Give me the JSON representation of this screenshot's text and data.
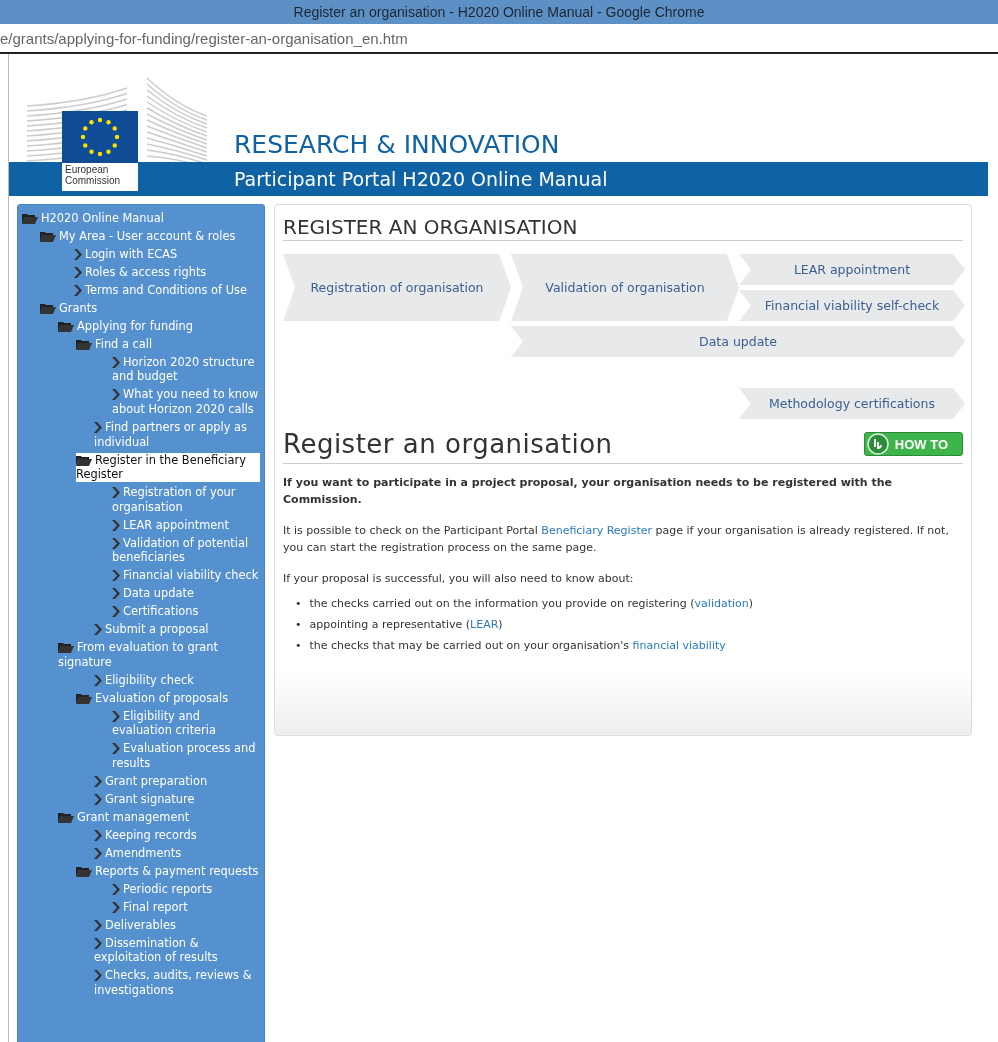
{
  "window": {
    "title": "Register an organisation - H2020 Online Manual - Google Chrome",
    "url": "e/grants/applying-for-funding/register-an-organisation_en.htm"
  },
  "header": {
    "logo_text": "European Commission",
    "title": "RESEARCH & INNOVATION",
    "subtitle": "Participant Portal H2020 Online Manual"
  },
  "sidebar": {
    "tree": [
      {
        "label": "H2020 Online Manual",
        "kind": "folder",
        "selected": false,
        "children": [
          {
            "label": "My Area - User account & roles",
            "kind": "folder",
            "selected": false,
            "children": [
              {
                "label": "Login with ECAS",
                "kind": "page",
                "selected": false
              },
              {
                "label": "Roles & access rights",
                "kind": "page",
                "selected": false
              },
              {
                "label": "Terms and Conditions of Use",
                "kind": "page",
                "selected": false
              }
            ]
          },
          {
            "label": "Grants",
            "kind": "folder",
            "selected": false,
            "children": [
              {
                "label": "Applying for funding",
                "kind": "folder",
                "selected": false,
                "children": [
                  {
                    "label": "Find a call",
                    "kind": "folder",
                    "selected": false,
                    "children": [
                      {
                        "label": "Horizon 2020 structure and budget",
                        "kind": "page",
                        "selected": false
                      },
                      {
                        "label": "What you need to know about Horizon 2020 calls",
                        "kind": "page",
                        "selected": false
                      }
                    ]
                  },
                  {
                    "label": "Find partners or apply as individual",
                    "kind": "page",
                    "selected": false
                  },
                  {
                    "label": "Register in the Beneficiary Register",
                    "kind": "folder",
                    "selected": true,
                    "children": [
                      {
                        "label": "Registration of your organisation",
                        "kind": "page",
                        "selected": false
                      },
                      {
                        "label": "LEAR appointment",
                        "kind": "page",
                        "selected": false
                      },
                      {
                        "label": "Validation of potential beneficiaries",
                        "kind": "page",
                        "selected": false
                      },
                      {
                        "label": "Financial viability check",
                        "kind": "page",
                        "selected": false
                      },
                      {
                        "label": "Data update",
                        "kind": "page",
                        "selected": false
                      },
                      {
                        "label": "Certifications",
                        "kind": "page",
                        "selected": false
                      }
                    ]
                  },
                  {
                    "label": "Submit a proposal",
                    "kind": "page",
                    "selected": false
                  }
                ]
              },
              {
                "label": "From evaluation to grant signature",
                "kind": "folder",
                "selected": false,
                "children": [
                  {
                    "label": "Eligibility check",
                    "kind": "page",
                    "selected": false
                  },
                  {
                    "label": "Evaluation of proposals",
                    "kind": "folder",
                    "selected": false,
                    "children": [
                      {
                        "label": "Eligibility and evaluation criteria",
                        "kind": "page",
                        "selected": false
                      },
                      {
                        "label": "Evaluation process and results",
                        "kind": "page",
                        "selected": false
                      }
                    ]
                  },
                  {
                    "label": "Grant preparation",
                    "kind": "page",
                    "selected": false
                  },
                  {
                    "label": "Grant signature",
                    "kind": "page",
                    "selected": false
                  }
                ]
              },
              {
                "label": "Grant management",
                "kind": "folder",
                "selected": false,
                "children": [
                  {
                    "label": "Keeping records",
                    "kind": "page",
                    "selected": false
                  },
                  {
                    "label": "Amendments",
                    "kind": "page",
                    "selected": false
                  },
                  {
                    "label": "Reports & payment requests",
                    "kind": "folder",
                    "selected": false,
                    "children": [
                      {
                        "label": "Periodic reports",
                        "kind": "page",
                        "selected": false
                      },
                      {
                        "label": "Final report",
                        "kind": "page",
                        "selected": false
                      }
                    ]
                  },
                  {
                    "label": "Deliverables",
                    "kind": "page",
                    "selected": false
                  },
                  {
                    "label": "Dissemination & exploitation of results",
                    "kind": "page",
                    "selected": false
                  },
                  {
                    "label": "Checks, audits, reviews & investigations",
                    "kind": "page",
                    "selected": false
                  }
                ]
              }
            ]
          }
        ]
      }
    ]
  },
  "content": {
    "section_title": "REGISTER AN ORGANISATION",
    "flow_steps": [
      {
        "label": "Registration of organisation"
      },
      {
        "label": "Validation of organisation"
      },
      {
        "label": "LEAR appointment"
      },
      {
        "label": "Financial viability self-check"
      },
      {
        "label": "Data update"
      },
      {
        "label": "Methodology certifications"
      }
    ],
    "page_title": "Register an organisation",
    "howto_button": "HOW TO",
    "intro": "If you want to participate in a project proposal, your organisation needs to be registered with the Commission.",
    "paragraphs": [
      {
        "before": "It is possible to check on the Participant Portal ",
        "link": "Beneficiary Register",
        "after": " page if your organisation is already registered. If not, you can start the registration process on the same page."
      },
      {
        "before": "If your proposal is successful, you will also need to know about:"
      }
    ],
    "bullets": [
      {
        "marker": "•",
        "before": "the checks carried out on the information you provide on registering (",
        "link": "validation",
        "after": ")"
      },
      {
        "marker": "•",
        "before": "appointing a representative (",
        "link": "LEAR",
        "after": ")"
      },
      {
        "marker": "•",
        "before": "the checks that may be carried out on your organisation's ",
        "link": "financial viability"
      }
    ]
  }
}
